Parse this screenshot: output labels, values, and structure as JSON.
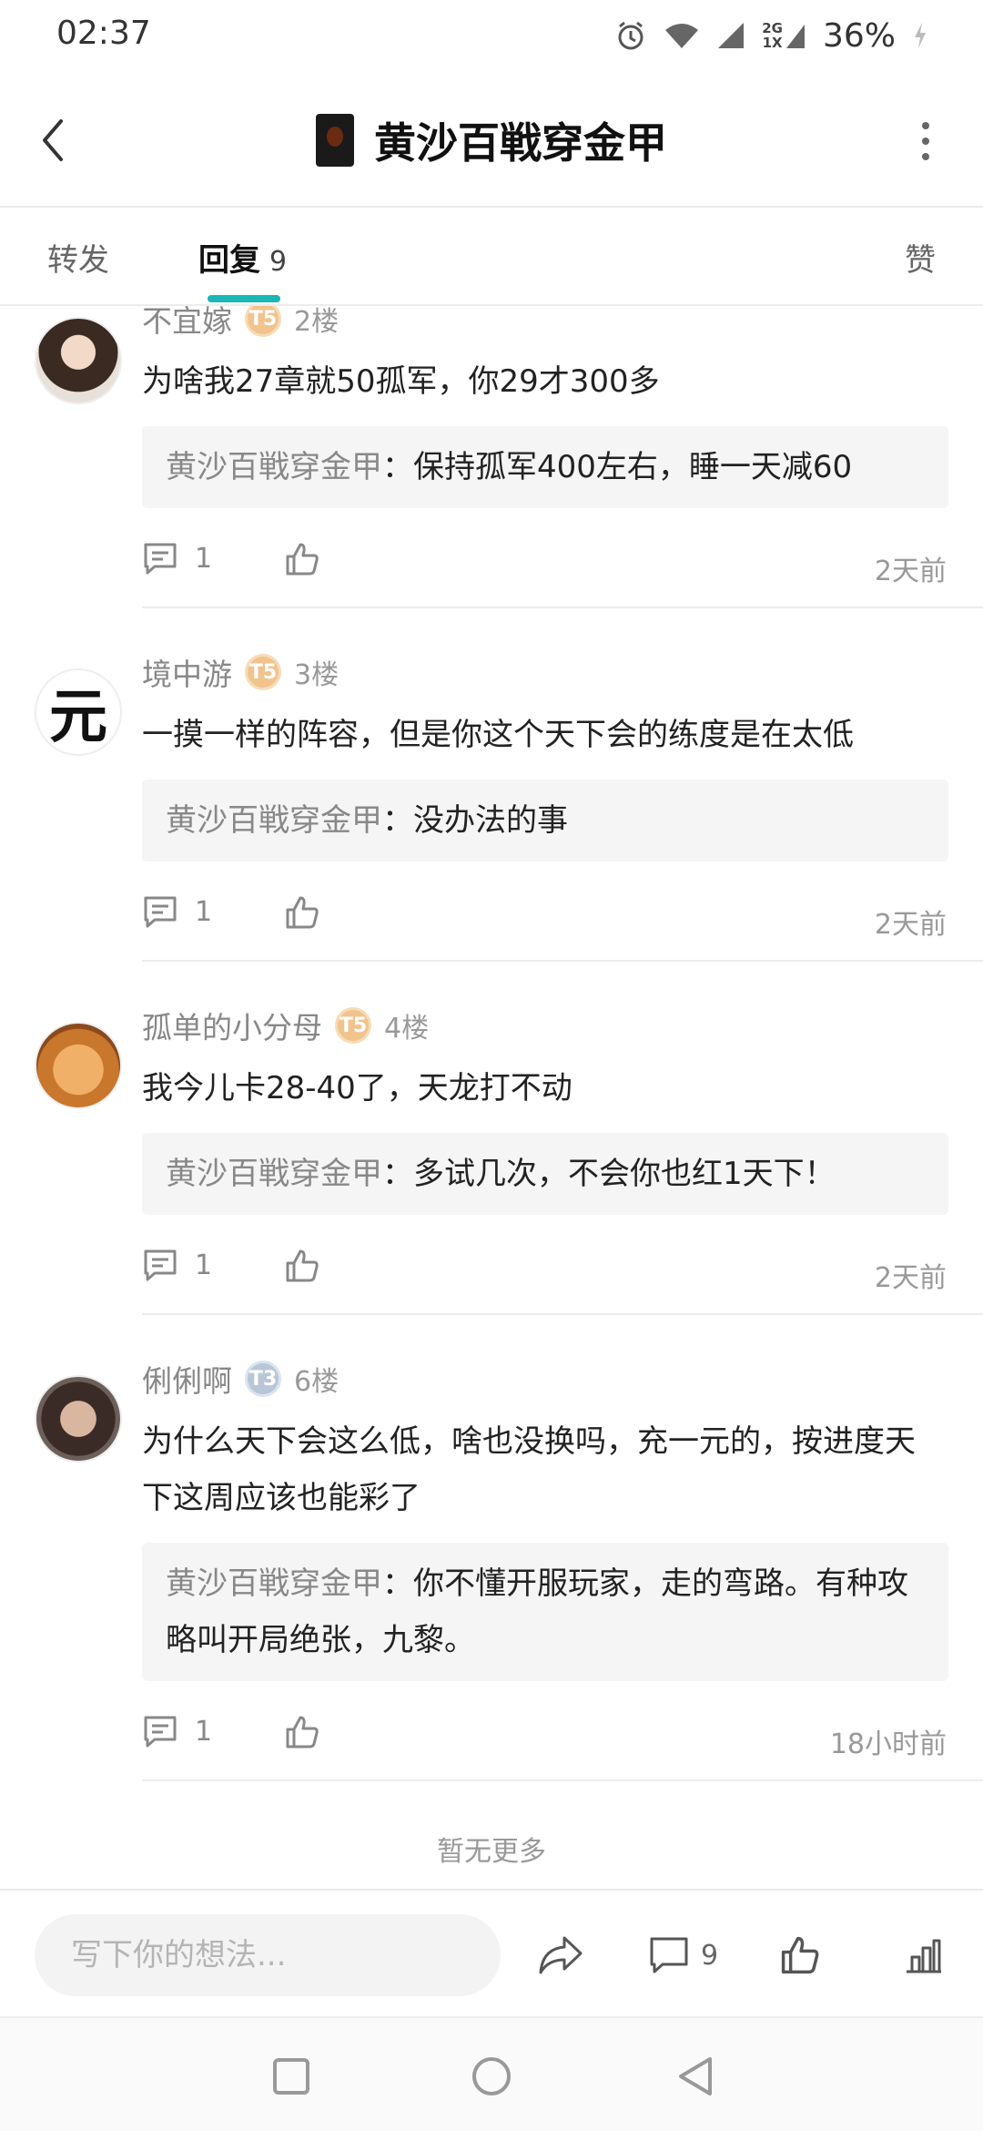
{
  "status_bar": {
    "time": "02:37",
    "network_top": "2G",
    "network_bottom": "1X",
    "battery": "36%"
  },
  "header": {
    "title": "黄沙百戦穿金甲"
  },
  "tabs": {
    "forward": "转发",
    "reply": "回复",
    "reply_count": "9",
    "like": "赞"
  },
  "comments": [
    {
      "user": "不宜嫁",
      "badge": "T5",
      "floor": "2楼",
      "text": "为啥我27章就50孤军，你29才300多",
      "reply_author": "黄沙百戦穿金甲",
      "reply_sep": "：",
      "reply_text": "保持孤军400左右，睡一天减60",
      "reply_count": "1",
      "time": "2天前"
    },
    {
      "user": "境中游",
      "badge": "T5",
      "floor": "3楼",
      "text": "一摸一样的阵容，但是你这个天下会的练度是在太低",
      "reply_author": "黄沙百戦穿金甲",
      "reply_sep": "：",
      "reply_text": "没办法的事",
      "reply_count": "1",
      "time": "2天前"
    },
    {
      "user": "孤单的小分母",
      "badge": "T5",
      "floor": "4楼",
      "text": "我今儿卡28-40了，天龙打不动",
      "reply_author": "黄沙百戦穿金甲",
      "reply_sep": "：",
      "reply_text": "多试几次，不会你也红1天下！",
      "reply_count": "1",
      "time": "2天前"
    },
    {
      "user": "俐俐啊",
      "badge": "T3",
      "floor": "6楼",
      "text": "为什么天下会这么低，啥也没换吗，充一元的，按进度天下这周应该也能彩了",
      "reply_author": "黄沙百戦穿金甲",
      "reply_sep": "：",
      "reply_text": "你不懂开服玩家，走的弯路。有种攻略叫开局绝张，九黎。",
      "reply_count": "1",
      "time": "18小时前"
    }
  ],
  "footer": {
    "no_more": "暂无更多"
  },
  "bottom_bar": {
    "placeholder": "写下你的想法...",
    "comment_count": "9"
  },
  "colors": {
    "accent": "#1bb5b5",
    "badge_gold": "#f1c38d",
    "badge_silver": "#b9c6d8"
  }
}
